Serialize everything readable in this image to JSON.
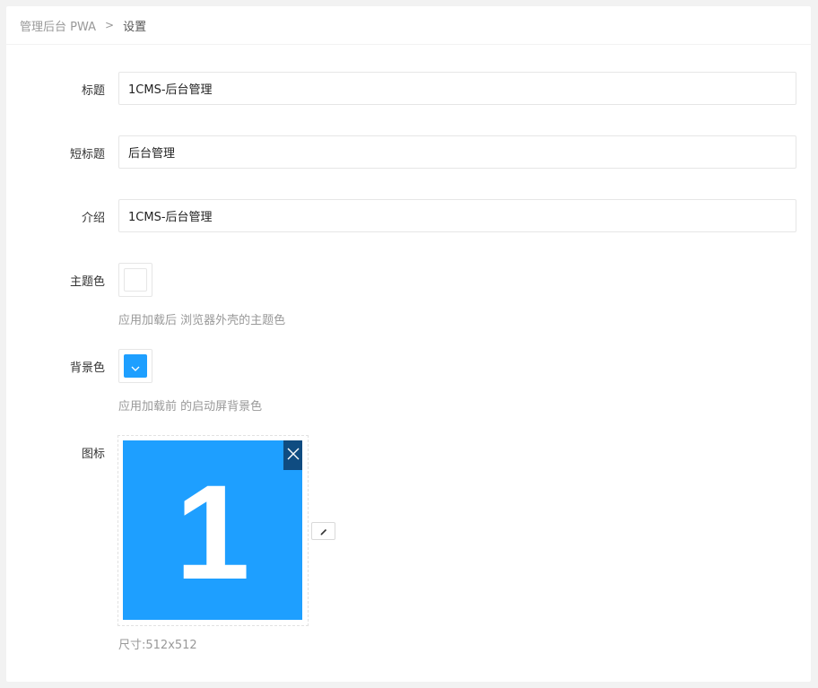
{
  "breadcrumb": {
    "parent": "管理后台 PWA",
    "separator": ">",
    "current": "设置"
  },
  "form": {
    "title": {
      "label": "标题",
      "value": "1CMS-后台管理"
    },
    "short_title": {
      "label": "短标题",
      "value": "后台管理"
    },
    "description": {
      "label": "介绍",
      "value": "1CMS-后台管理"
    },
    "theme_color": {
      "label": "主题色",
      "color": "#ffffff",
      "help": "应用加载后 浏览器外壳的主题色"
    },
    "background_color": {
      "label": "背景色",
      "color": "#1e9fff",
      "help": "应用加载前 的启动屏背景色"
    },
    "icon": {
      "label": "图标",
      "glyph": "1",
      "background": "#1e9fff",
      "remove_icon": "close-icon",
      "edit_icon": "pencil-icon",
      "size_note": "尺寸:512x512"
    }
  }
}
